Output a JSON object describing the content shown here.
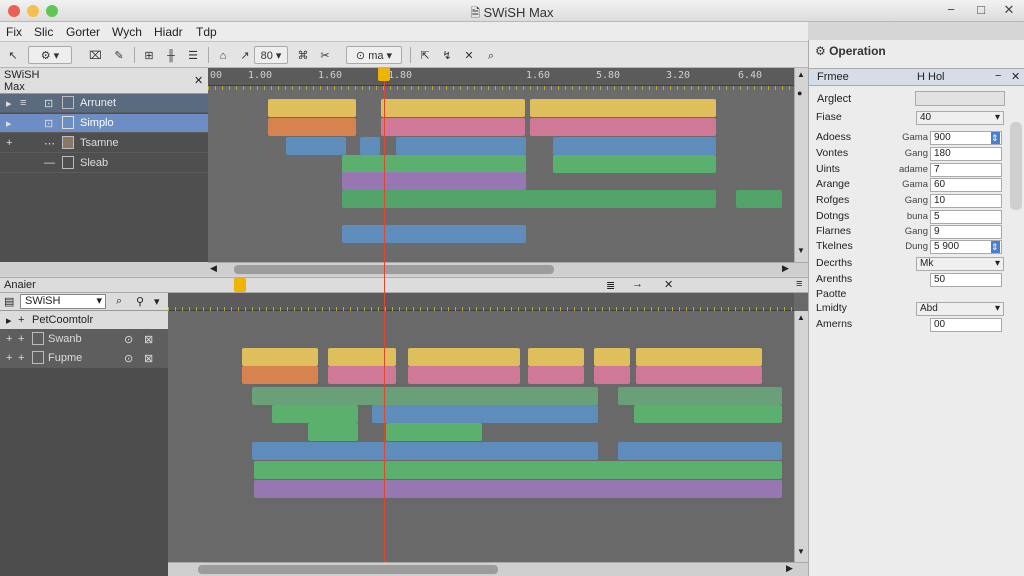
{
  "window": {
    "title": "SWiSH Max",
    "controls": [
      "−",
      "□",
      "✕"
    ]
  },
  "menu": [
    "Fix",
    "Slic",
    "Gorter",
    "Wych",
    "Hiadr",
    "Tdp"
  ],
  "toolbar": {
    "zoom_a": "80",
    "zoom_b": "ma"
  },
  "timeline_top": {
    "panel_title": "SWiSH Max",
    "ruler": [
      "00",
      "1.00",
      "1.60",
      "1.80",
      "1.60",
      "5.80",
      "3.20",
      "6.40"
    ],
    "rows": [
      {
        "label": "Arrunet"
      },
      {
        "label": "Simplo"
      },
      {
        "label": "Tsamne"
      },
      {
        "label": "Sleab"
      }
    ]
  },
  "timeline_bottom": {
    "header": "Anaier",
    "dropdown": "SWiSH",
    "group": "PetCoomtolr",
    "rows": [
      {
        "label": "Swanb"
      },
      {
        "label": "Fupme"
      }
    ]
  },
  "properties": {
    "title": "Operation",
    "section": "Frmee",
    "section_value": "H Hol",
    "arglabel": "Arglect",
    "select_value": "40",
    "rows": [
      {
        "label": "Fiase",
        "unit": "",
        "value": "40",
        "kind": "select"
      },
      {
        "label": "Adoess",
        "unit": "Gama",
        "value": "900",
        "kind": "spin"
      },
      {
        "label": "Vontes",
        "unit": "Gang",
        "value": "180",
        "kind": "text"
      },
      {
        "label": "Uints",
        "unit": "adame",
        "value": "7",
        "kind": "text"
      },
      {
        "label": "Arange",
        "unit": "Gama",
        "value": "60",
        "kind": "text"
      },
      {
        "label": "Rofges",
        "unit": "Gang",
        "value": "10",
        "kind": "text"
      },
      {
        "label": "Dotngs",
        "unit": "buna",
        "value": "5",
        "kind": "text"
      },
      {
        "label": "Flarnes",
        "unit": "Gang",
        "value": "9",
        "kind": "text"
      },
      {
        "label": "Tkelnes",
        "unit": "Dung",
        "value": "5 900",
        "kind": "spin"
      },
      {
        "label": "Decrths",
        "unit": "",
        "value": "Mk",
        "kind": "select"
      },
      {
        "label": "Arenths",
        "unit": "",
        "value": "50",
        "kind": "text"
      },
      {
        "label": "Paotte",
        "unit": "",
        "value": "",
        "kind": "none"
      },
      {
        "label": "Lmidty",
        "unit": "",
        "value": "Abd",
        "kind": "select"
      },
      {
        "label": "Amerns",
        "unit": "",
        "value": "00",
        "kind": "text"
      }
    ]
  },
  "colors": {
    "yellow": "#e9c75a",
    "pink": "#d8799b",
    "orange": "#e0864e",
    "blue": "#5d8fc2",
    "green": "#5bb66f",
    "purple": "#9b78b8",
    "playhead": "#e0482e"
  }
}
